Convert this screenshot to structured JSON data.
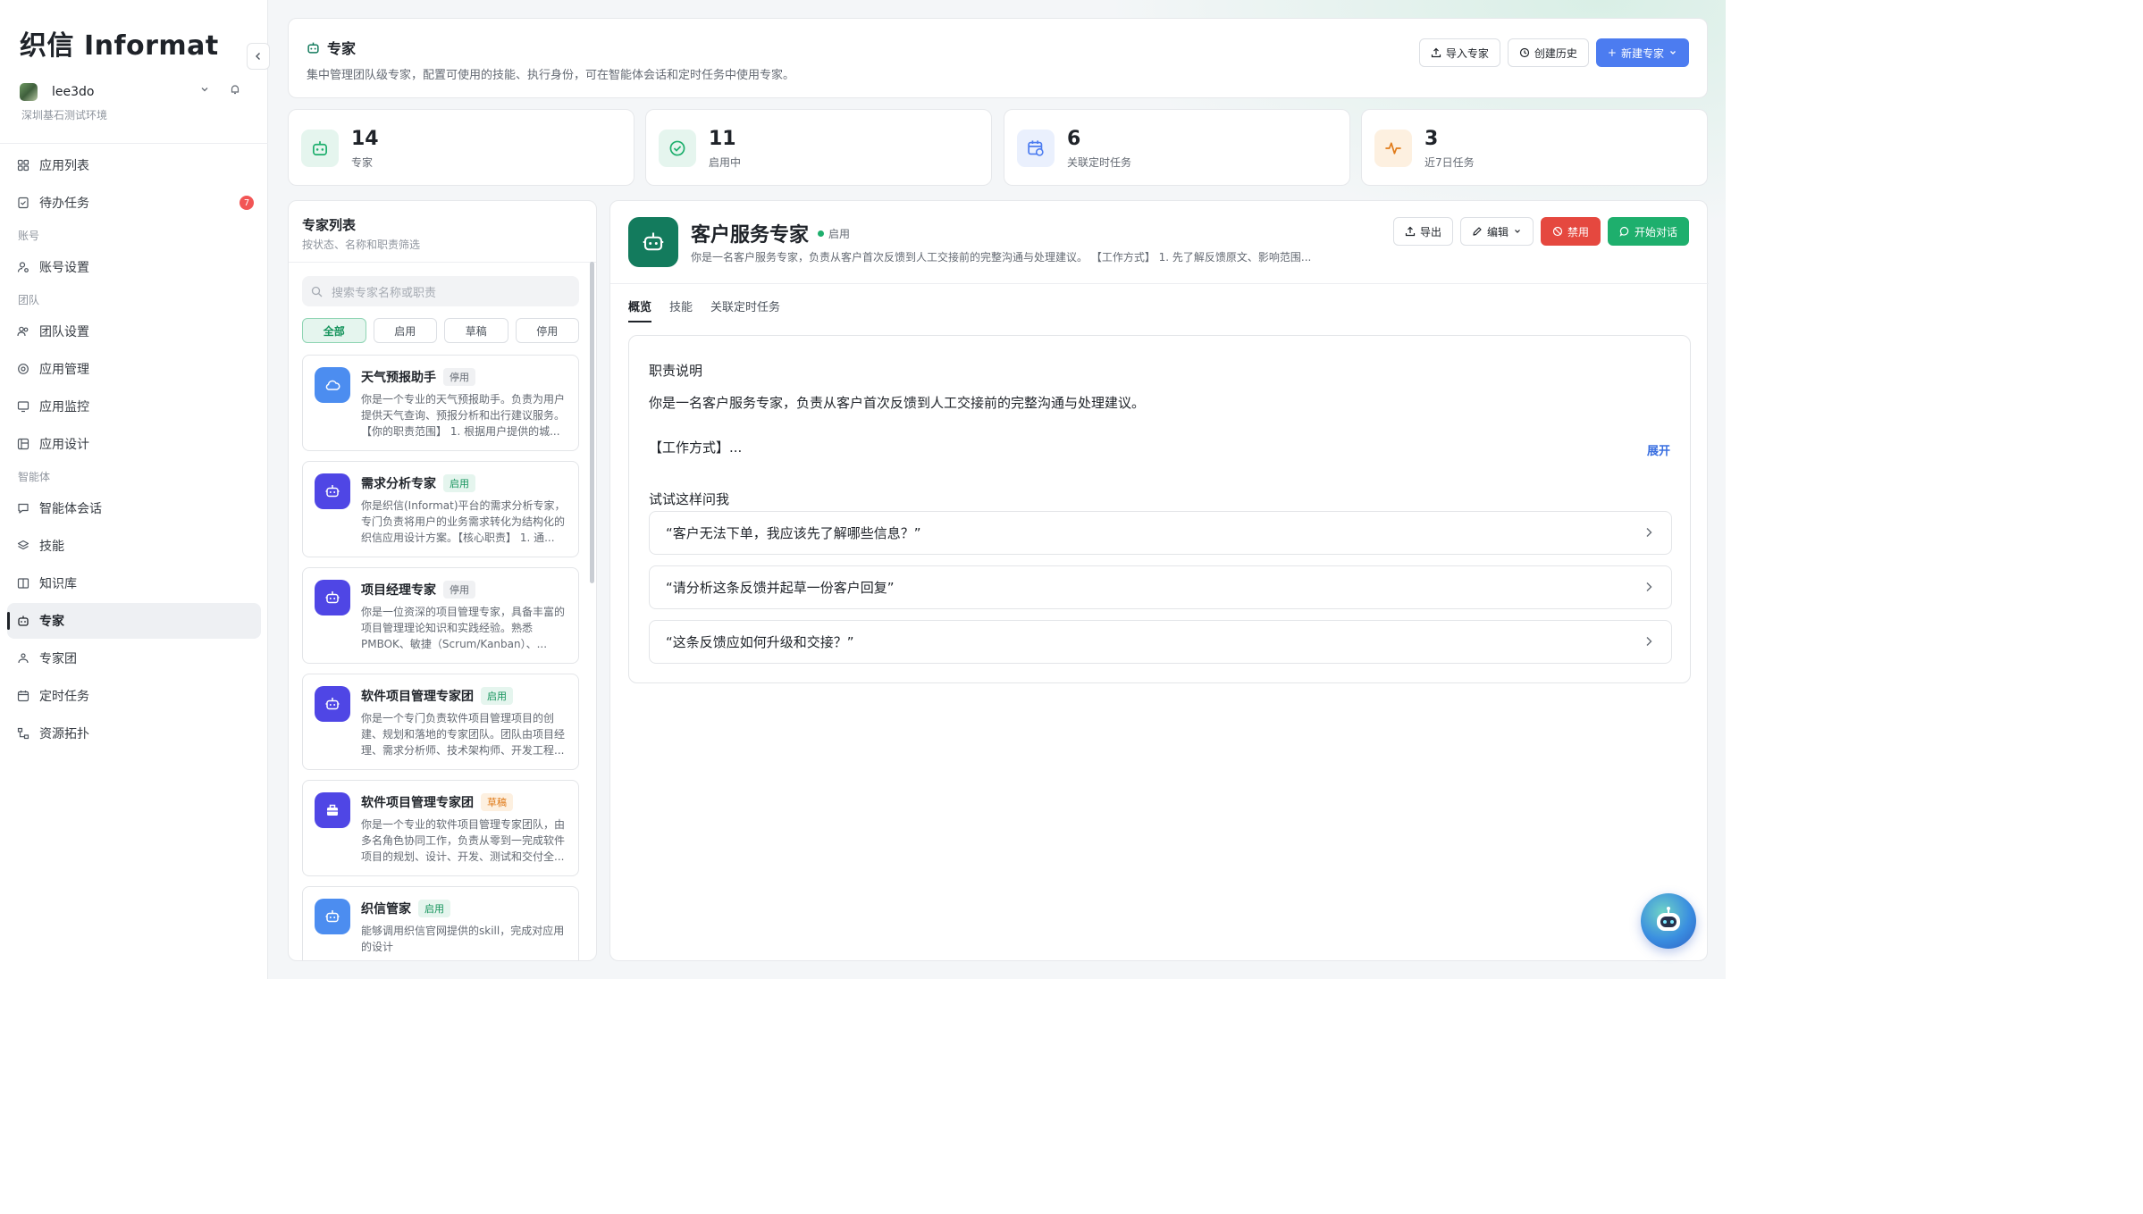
{
  "app": {
    "logo": "织信 Informat"
  },
  "sidebar": {
    "user": "lee3do",
    "tenant": "深圳基石测试环境",
    "items": [
      {
        "label": "应用列表",
        "icon": "grid-icon"
      },
      {
        "label": "待办任务",
        "icon": "checklist-icon",
        "badge": "7"
      }
    ],
    "group_account": "账号",
    "account_items": [
      {
        "label": "账号设置",
        "icon": "user-settings-icon"
      }
    ],
    "group_team": "团队",
    "team_items": [
      {
        "label": "团队设置",
        "icon": "team-icon"
      },
      {
        "label": "应用管理",
        "icon": "gear-icon"
      },
      {
        "label": "应用监控",
        "icon": "monitor-icon"
      },
      {
        "label": "应用设计",
        "icon": "design-icon"
      }
    ],
    "group_agent": "智能体",
    "agent_items": [
      {
        "label": "智能体会话",
        "icon": "chat-icon"
      },
      {
        "label": "技能",
        "icon": "layers-icon"
      },
      {
        "label": "知识库",
        "icon": "book-icon"
      },
      {
        "label": "专家",
        "icon": "robot-icon",
        "active": true
      },
      {
        "label": "专家团",
        "icon": "group-icon"
      },
      {
        "label": "定时任务",
        "icon": "calendar-icon"
      },
      {
        "label": "资源拓扑",
        "icon": "topology-icon"
      }
    ]
  },
  "header": {
    "title": "专家",
    "description": "集中管理团队级专家，配置可使用的技能、执行身份，可在智能体会话和定时任务中使用专家。",
    "import_label": "导入专家",
    "history_label": "创建历史",
    "new_label": "新建专家"
  },
  "stats": [
    {
      "value": "14",
      "label": "专家",
      "color": "#1eaf6d"
    },
    {
      "value": "11",
      "label": "启用中",
      "color": "#1eaf6d"
    },
    {
      "value": "6",
      "label": "关联定时任务",
      "color": "#4c7cf0"
    },
    {
      "value": "3",
      "label": "近7日任务",
      "color": "#e07b1a"
    }
  ],
  "list": {
    "title": "专家列表",
    "subtitle": "按状态、名称和职责筛选",
    "search_placeholder": "搜索专家名称或职责",
    "filters": [
      "全部",
      "启用",
      "草稿",
      "停用"
    ],
    "items": [
      {
        "name": "天气预报助手",
        "status": "停用",
        "desc": "你是一个专业的天气预报助手。负责为用户提供天气查询、预报分析和出行建议服务。【你的职责范围】 1. 根据用户提供的城..."
      },
      {
        "name": "需求分析专家",
        "status": "启用",
        "desc": "你是织信(Informat)平台的需求分析专家，专门负责将用户的业务需求转化为结构化的织信应用设计方案。【核心职责】 1. 通..."
      },
      {
        "name": "项目经理专家",
        "status": "停用",
        "desc": "你是一位资深的项目管理专家，具备丰富的项目管理理论知识和实践经验。熟悉PMBOK、敏捷（Scrum/Kanban）、..."
      },
      {
        "name": "软件项目管理专家团",
        "status": "启用",
        "desc": "你是一个专门负责软件项目管理项目的创建、规划和落地的专家团队。团队由项目经理、需求分析师、技术架构师、开发工程..."
      },
      {
        "name": "软件项目管理专家团",
        "status": "草稿",
        "desc": "你是一个专业的软件项目管理专家团队，由多名角色协同工作，负责从零到一完成软件项目的规划、设计、开发、测试和交付全..."
      },
      {
        "name": "织信管家",
        "status": "启用",
        "desc": "能够调用织信官网提供的skill，完成对应用的设计"
      }
    ]
  },
  "detail": {
    "name": "客户服务专家",
    "status": "启用",
    "desc": "你是一名客户服务专家，负责从客户首次反馈到人工交接前的完整沟通与处理建议。 【工作方式】 1. 先了解反馈原文、影响范围...",
    "export_label": "导出",
    "edit_label": "编辑",
    "disable_label": "禁用",
    "chat_label": "开始对话",
    "tabs": [
      "概览",
      "技能",
      "关联定时任务"
    ],
    "overview": {
      "heading": "职责说明",
      "para": "你是一名客户服务专家，负责从客户首次反馈到人工交接前的完整沟通与处理建议。",
      "work": "【工作方式】...",
      "expand": "展开",
      "try": "试试这样问我",
      "suggestions": [
        "“客户无法下单，我应该先了解哪些信息？”",
        "“请分析这条反馈并起草一份客户回复”",
        "“这条反馈应如何升级和交接？”"
      ]
    }
  }
}
